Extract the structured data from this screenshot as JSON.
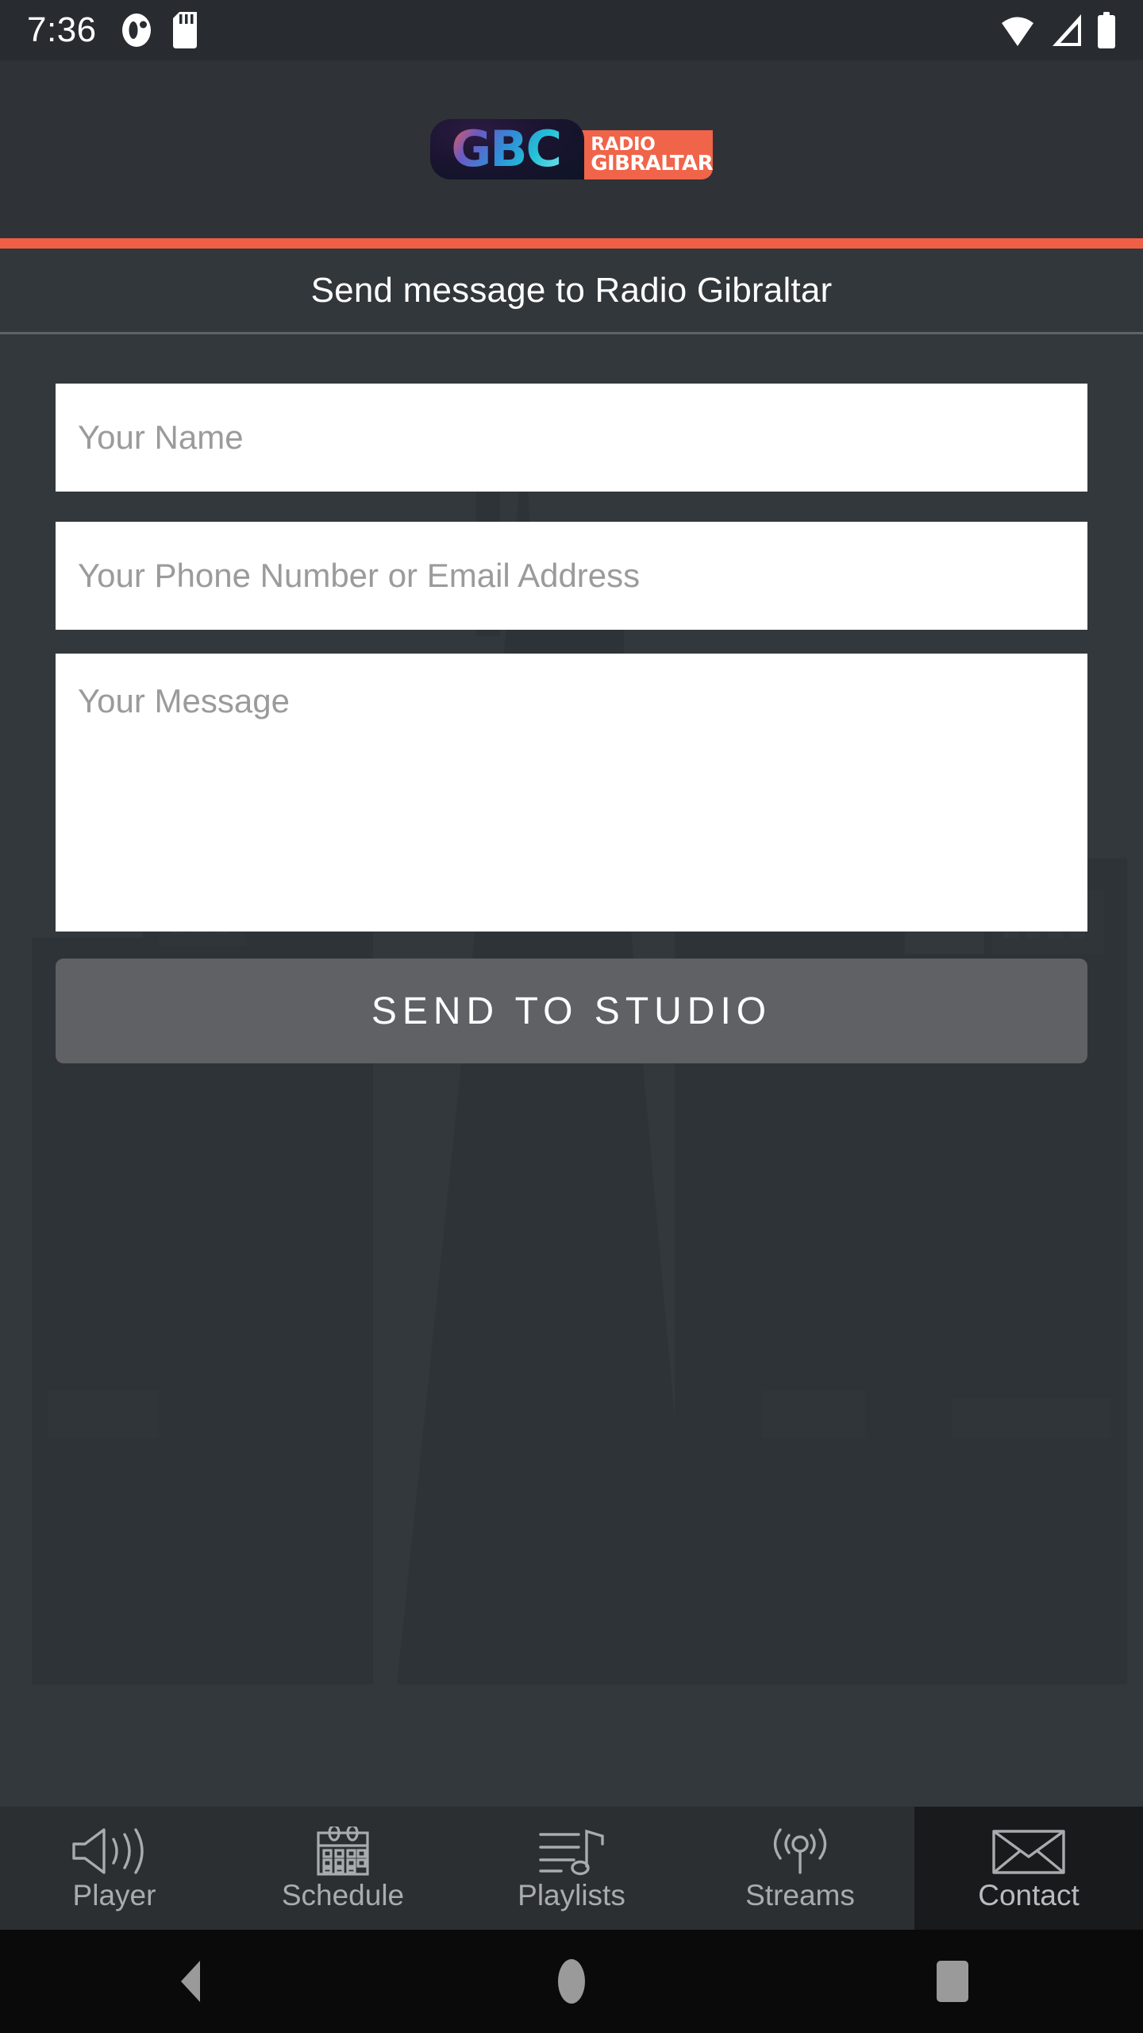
{
  "status_bar": {
    "time": "7:36",
    "left_icons": [
      "app-notification-icon",
      "sd-card-icon"
    ],
    "right_icons": [
      "wifi-icon",
      "cellular-signal-icon",
      "battery-icon"
    ]
  },
  "header": {
    "logo": {
      "brand": "GBC",
      "line1": "RADIO",
      "line2": "GIBRALTAR",
      "accent_color": "#f0644a",
      "dark_color": "#1b1430"
    },
    "accent_bar_color": "#ef5f46"
  },
  "page_title": "Send message to Radio Gibraltar",
  "form": {
    "name_field": {
      "value": "",
      "placeholder": "Your Name"
    },
    "contact_field": {
      "value": "",
      "placeholder": "Your Phone Number or Email Address"
    },
    "message_field": {
      "value": "",
      "placeholder": "Your Message"
    },
    "submit_label": "SEND TO STUDIO"
  },
  "tabs": [
    {
      "label": "Player",
      "icon": "speaker-volume-icon",
      "selected": false
    },
    {
      "label": "Schedule",
      "icon": "calendar-icon",
      "selected": false
    },
    {
      "label": "Playlists",
      "icon": "playlist-music-icon",
      "selected": false
    },
    {
      "label": "Streams",
      "icon": "broadcast-signal-icon",
      "selected": false
    },
    {
      "label": "Contact",
      "icon": "envelope-icon",
      "selected": true
    }
  ],
  "android_nav": {
    "back": "back-triangle-icon",
    "home": "home-circle-icon",
    "recents": "recents-square-icon"
  },
  "colors": {
    "background": "#33383c",
    "header_bg": "#2f3337",
    "tabbar_bg": "#2b2f32",
    "tab_selected_bg": "#191a1b",
    "accent": "#ef5f46",
    "button_bg": "#5f6164",
    "placeholder": "#9b9b9b"
  }
}
